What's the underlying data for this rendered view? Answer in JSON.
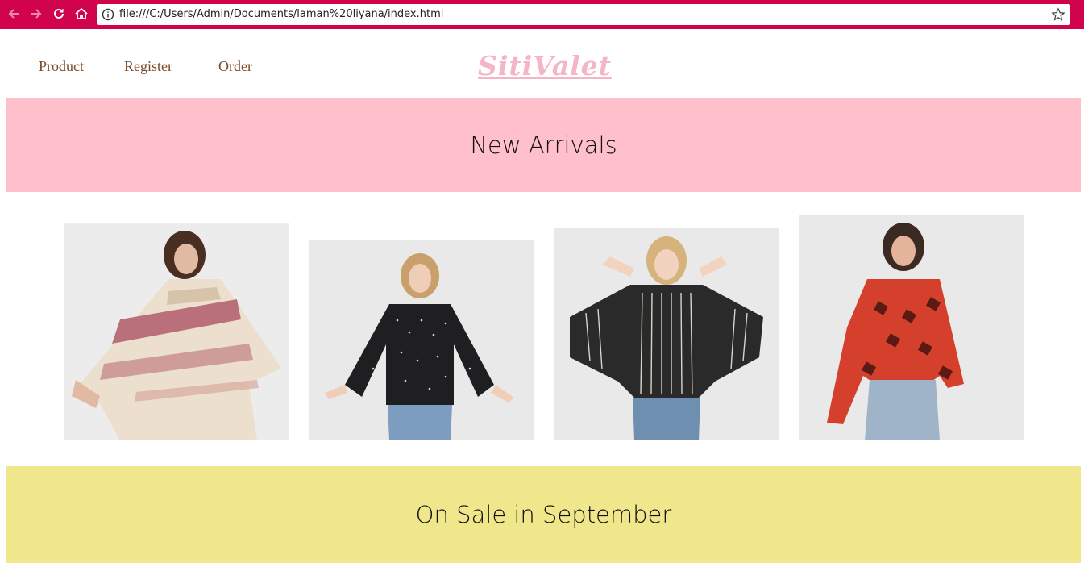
{
  "browser": {
    "url": "file:///C:/Users/Admin/Documents/laman%20liyana/index.html",
    "chrome_color": "#d0034c",
    "icons": [
      "back-icon",
      "forward-icon",
      "reload-icon",
      "home-icon",
      "info-icon",
      "star-icon"
    ]
  },
  "nav": {
    "links": [
      {
        "label": "Product"
      },
      {
        "label": "Register"
      },
      {
        "label": "Order"
      }
    ],
    "brand": "SitiValet",
    "brand_color": "#f4b6c6",
    "link_color": "#7b4b2a"
  },
  "sections": {
    "new_arrivals": {
      "title": "New Arrivals",
      "color": "#ffbfcb"
    },
    "on_sale": {
      "title": "On Sale in September",
      "color": "#f0e68c"
    }
  },
  "products": [
    {
      "alt": "striped poncho"
    },
    {
      "alt": "black dotted blouse"
    },
    {
      "alt": "striped knit sweater"
    },
    {
      "alt": "red printed shirt"
    }
  ]
}
